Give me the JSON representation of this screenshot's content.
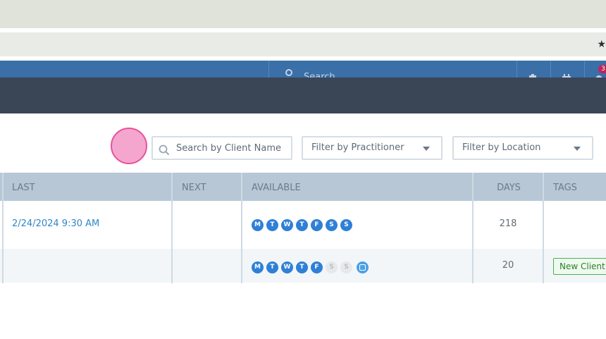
{
  "header": {
    "search_placeholder": "Search",
    "notification_count": "3"
  },
  "filters": {
    "search_placeholder": "Search by Client Name",
    "practitioner_label": "Filter by Practitioner",
    "location_label": "Filter by Location"
  },
  "table": {
    "columns": [
      "LAST",
      "NEXT",
      "AVAILABLE",
      "DAYS",
      "TAGS"
    ],
    "rows": [
      {
        "last": "2/24/2024 9:30 AM",
        "next": "",
        "available": [
          {
            "letter": "M",
            "on": true
          },
          {
            "letter": "T",
            "on": true
          },
          {
            "letter": "W",
            "on": true
          },
          {
            "letter": "T",
            "on": true
          },
          {
            "letter": "F",
            "on": true
          },
          {
            "letter": "S",
            "on": true
          },
          {
            "letter": "S",
            "on": true
          }
        ],
        "has_note": false,
        "days": "218",
        "tag": ""
      },
      {
        "last": "",
        "next": "",
        "available": [
          {
            "letter": "M",
            "on": true
          },
          {
            "letter": "T",
            "on": true
          },
          {
            "letter": "W",
            "on": true
          },
          {
            "letter": "T",
            "on": true
          },
          {
            "letter": "F",
            "on": true
          },
          {
            "letter": "S",
            "on": false
          },
          {
            "letter": "S",
            "on": false
          }
        ],
        "has_note": true,
        "days": "20",
        "tag": "New Client"
      }
    ]
  },
  "colors": {
    "header_blue": "#3a6fa8",
    "subheader_slate": "#3a4556",
    "day_active": "#2f80d6",
    "link": "#2f86c6",
    "tag_green": "#4caf50",
    "click_marker": "#f4a6cf"
  },
  "icons": {
    "bookmark": "star-icon",
    "header_search": "search-icon",
    "filter_search": "search-icon",
    "header_1": "clipboard-icon",
    "header_2": "calendar-icon",
    "header_3": "bell-icon",
    "select_caret": "caret-down-icon",
    "note": "note-icon"
  }
}
